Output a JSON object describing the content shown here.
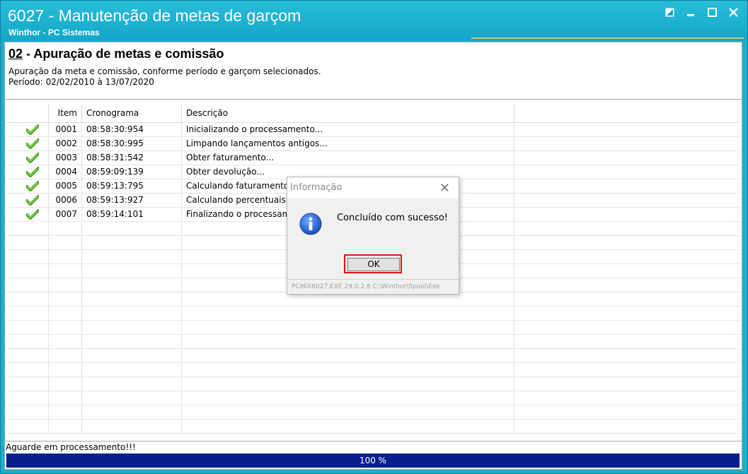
{
  "window": {
    "title": "6027 - Manutenção de metas de garçom",
    "subtitle": "Winthor - PC Sistemas",
    "controls": [
      "restore-icon",
      "minimize-icon",
      "maximize-icon",
      "close-icon"
    ]
  },
  "header": {
    "step_number": "02",
    "step_title": " - Apuração de metas e comissão",
    "description": "Apuração da meta e comissão, conforme período e garçom selecionados.",
    "period": "Período: 02/02/2010 à 13/07/2020"
  },
  "grid": {
    "columns": [
      "",
      "Item",
      "Cronograma",
      "Descrição"
    ],
    "rows": [
      {
        "icon": "check-icon",
        "item": "0001",
        "time": "08:58:30:954",
        "desc": "Inicializando o processamento..."
      },
      {
        "icon": "check-icon",
        "item": "0002",
        "time": "08:58:30:995",
        "desc": "Limpando lançamentos antigos..."
      },
      {
        "icon": "check-icon",
        "item": "0003",
        "time": "08:58:31:542",
        "desc": "Obter faturamento..."
      },
      {
        "icon": "check-icon",
        "item": "0004",
        "time": "08:59:09:139",
        "desc": "Obter devolução..."
      },
      {
        "icon": "check-icon",
        "item": "0005",
        "time": "08:59:13:795",
        "desc": "Calculando faturamento li"
      },
      {
        "icon": "check-icon",
        "item": "0006",
        "time": "08:59:13:927",
        "desc": "Calculando percentuais..."
      },
      {
        "icon": "check-icon",
        "item": "0007",
        "time": "08:59:14:101",
        "desc": "Finalizando o processame"
      }
    ]
  },
  "status": {
    "text": "Aguarde em processamento!!!",
    "progress_label": "100 %",
    "progress_value": 100
  },
  "dialog": {
    "title": "Informação",
    "message": "Concluído com sucesso!",
    "ok_label": "OK",
    "footer": "PCMIX6027.EXE 29.0.2.8 C:\\Winthor\\Spool\\Exe",
    "icon": "info-icon",
    "highlight_color": "#e0101a"
  },
  "colors": {
    "titlebar": "#1bb0d0",
    "progress": "#0a1f8f",
    "check": "#5cb82c"
  }
}
